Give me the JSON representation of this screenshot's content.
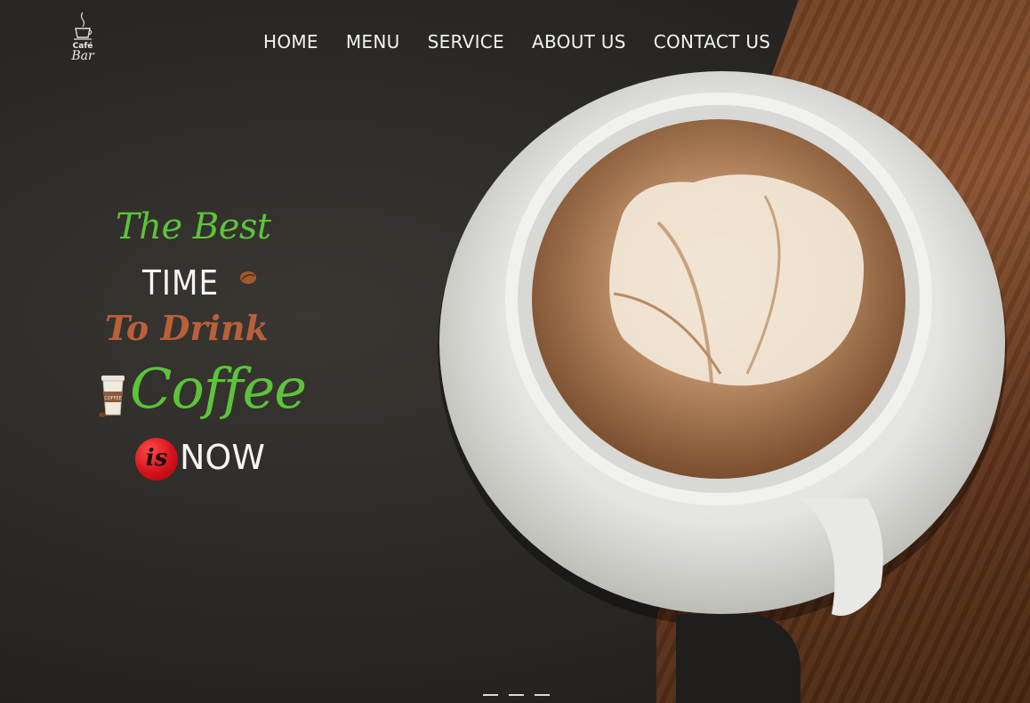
{
  "logo": {
    "line1": "Café",
    "line2": "Bar",
    "icon": "coffee-cup-icon"
  },
  "nav": {
    "items": [
      {
        "label": "HOME"
      },
      {
        "label": "MENU"
      },
      {
        "label": "SERVICE"
      },
      {
        "label": "ABOUT US"
      },
      {
        "label": "CONTACT US"
      }
    ]
  },
  "headline": {
    "line1": "The Best",
    "line2": "TIME",
    "line3": "To Drink",
    "line4": "Coffee",
    "badge": "is",
    "line5": "NOW",
    "cup_label": "COFFEE"
  },
  "slider": {
    "count": 3
  },
  "colors": {
    "green": "#5cc43a",
    "brown": "#b9603a",
    "red": "#d4121b",
    "nav_text": "#f2f2f2"
  }
}
